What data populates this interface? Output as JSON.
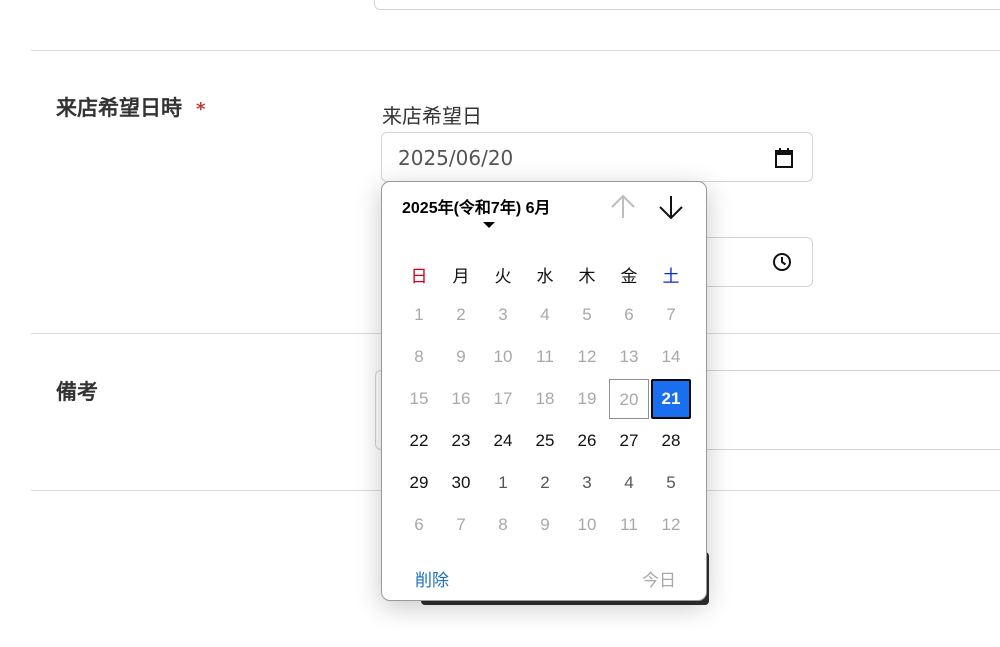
{
  "form": {
    "visit_datetime_label": "来店希望日時",
    "required_mark": "*",
    "visit_date_label": "来店希望日",
    "visit_date_value": "2025/06/20",
    "notes_label": "備考"
  },
  "picker": {
    "month_title": "2025年(令和7年) 6月",
    "weekdays": [
      "日",
      "月",
      "火",
      "水",
      "木",
      "金",
      "土"
    ],
    "days": [
      {
        "d": "1",
        "s": "out"
      },
      {
        "d": "2",
        "s": "out"
      },
      {
        "d": "3",
        "s": "out"
      },
      {
        "d": "4",
        "s": "out"
      },
      {
        "d": "5",
        "s": "out"
      },
      {
        "d": "6",
        "s": "out"
      },
      {
        "d": "7",
        "s": "out"
      },
      {
        "d": "8",
        "s": "out"
      },
      {
        "d": "9",
        "s": "out"
      },
      {
        "d": "10",
        "s": "out"
      },
      {
        "d": "11",
        "s": "out"
      },
      {
        "d": "12",
        "s": "out"
      },
      {
        "d": "13",
        "s": "out"
      },
      {
        "d": "14",
        "s": "out"
      },
      {
        "d": "15",
        "s": "out"
      },
      {
        "d": "16",
        "s": "out"
      },
      {
        "d": "17",
        "s": "out"
      },
      {
        "d": "18",
        "s": "out"
      },
      {
        "d": "19",
        "s": "out"
      },
      {
        "d": "20",
        "s": "today"
      },
      {
        "d": "21",
        "s": "selected"
      },
      {
        "d": "22",
        "s": "in"
      },
      {
        "d": "23",
        "s": "in"
      },
      {
        "d": "24",
        "s": "in"
      },
      {
        "d": "25",
        "s": "in"
      },
      {
        "d": "26",
        "s": "in"
      },
      {
        "d": "27",
        "s": "in"
      },
      {
        "d": "28",
        "s": "in"
      },
      {
        "d": "29",
        "s": "in"
      },
      {
        "d": "30",
        "s": "in"
      },
      {
        "d": "1",
        "s": "next"
      },
      {
        "d": "2",
        "s": "next"
      },
      {
        "d": "3",
        "s": "next"
      },
      {
        "d": "4",
        "s": "next"
      },
      {
        "d": "5",
        "s": "next"
      },
      {
        "d": "6",
        "s": "out"
      },
      {
        "d": "7",
        "s": "out"
      },
      {
        "d": "8",
        "s": "out"
      },
      {
        "d": "9",
        "s": "out"
      },
      {
        "d": "10",
        "s": "out"
      },
      {
        "d": "11",
        "s": "out"
      },
      {
        "d": "12",
        "s": "out"
      }
    ],
    "clear_label": "削除",
    "today_label": "今日"
  },
  "icons": {
    "date_input": "calendar-icon",
    "time_input": "clock-icon",
    "prev_month": "arrow-up-icon",
    "next_month": "arrow-down-icon"
  },
  "colors": {
    "selected_day": "#1a6ef0",
    "sunday": "#d0021b",
    "saturday": "#0a2bd8",
    "required": "#c0392b",
    "clear_link": "#1a6fc2"
  }
}
